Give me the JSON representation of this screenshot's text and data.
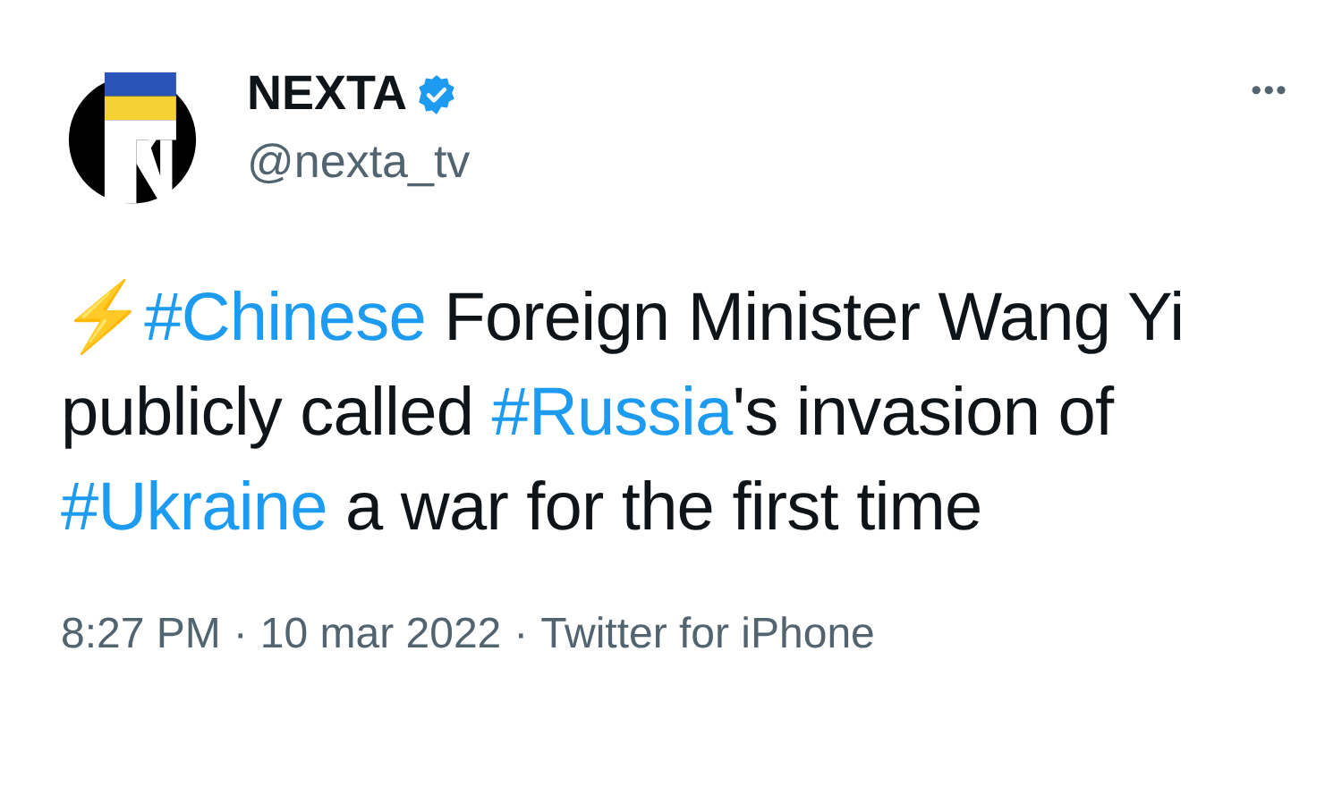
{
  "author": {
    "name": "NEXTA",
    "verified": true,
    "handle": "@nexta_tv"
  },
  "more_button": "•••",
  "tweet_text": [
    {
      "kind": "plain",
      "text": "⚡"
    },
    {
      "kind": "hashtag",
      "text": "#Chinese"
    },
    {
      "kind": "plain",
      "text": " Foreign Minister Wang Yi publicly called "
    },
    {
      "kind": "hashtag",
      "text": "#Russia"
    },
    {
      "kind": "plain",
      "text": "'s invasion of "
    },
    {
      "kind": "hashtag",
      "text": "#Ukraine"
    },
    {
      "kind": "plain",
      "text": " a war for the first time"
    }
  ],
  "meta": [
    {
      "kind": "text",
      "text": "8:27 PM"
    },
    {
      "kind": "separator",
      "text": "·"
    },
    {
      "kind": "text",
      "text": "10 mar 2022"
    },
    {
      "kind": "separator",
      "text": "·"
    },
    {
      "kind": "text",
      "text": "Twitter for iPhone"
    }
  ]
}
